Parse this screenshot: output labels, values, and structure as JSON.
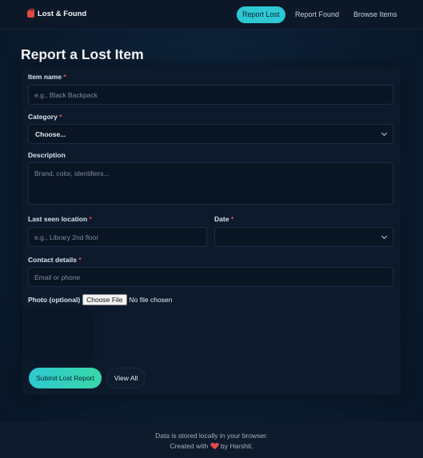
{
  "app": {
    "brand_name": "Lost & Found",
    "brand_icon": "backpack-icon"
  },
  "nav": {
    "items": [
      {
        "label": "Report Lost",
        "active": true
      },
      {
        "label": "Report Found",
        "active": false
      },
      {
        "label": "Browse Items",
        "active": false
      }
    ]
  },
  "page": {
    "title": "Report a Lost Item"
  },
  "form": {
    "item_name": {
      "label": "Item name",
      "required_mark": "*",
      "placeholder": "e.g., Black Backpack",
      "value": ""
    },
    "category": {
      "label": "Category",
      "required_mark": "*",
      "selected": "Choose..."
    },
    "description": {
      "label": "Description",
      "placeholder": "Brand, color, identifiers...",
      "value": ""
    },
    "location": {
      "label": "Last seen location",
      "required_mark": "*",
      "placeholder": "e.g., Library 2nd floor",
      "value": ""
    },
    "date": {
      "label": "Date",
      "required_mark": "*",
      "value": ""
    },
    "contact": {
      "label": "Contact details",
      "required_mark": "*",
      "placeholder": "Email or phone",
      "value": ""
    },
    "photo": {
      "label": "Photo (optional)",
      "button_label": "Choose File",
      "status": "No file chosen"
    },
    "submit_label": "Submit Lost Report",
    "view_all_label": "View All"
  },
  "footer": {
    "line1": "Data is stored locally in your browser.",
    "line2_prefix": "Created with",
    "line2_suffix": "by Harshit."
  },
  "colors": {
    "accent": "#2dc8d3",
    "accent_gradient_end": "#39d6a8",
    "required": "#f05252",
    "heart": "#e5484d"
  }
}
